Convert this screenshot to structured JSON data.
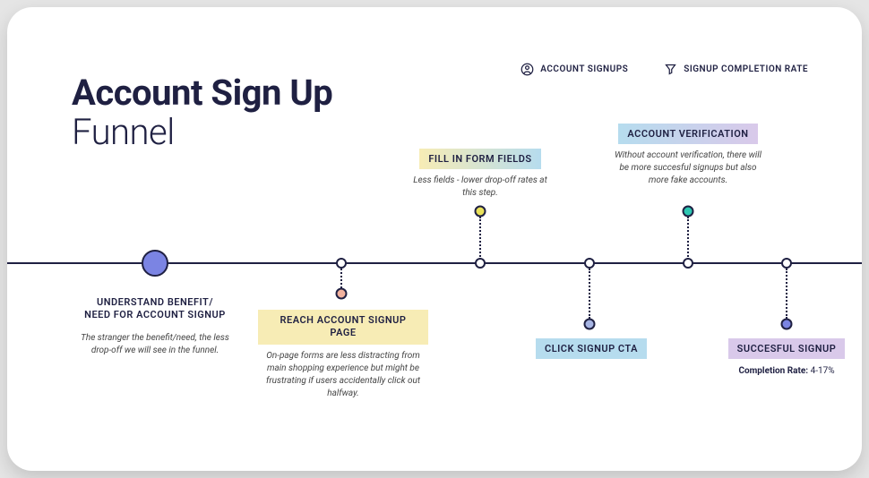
{
  "title": {
    "main": "Account Sign Up",
    "sub": "Funnel"
  },
  "legend": {
    "signups": "ACCOUNT SIGNUPS",
    "completion": "SIGNUP COMPLETION RATE"
  },
  "steps": {
    "s1": {
      "label": "UNDERSTAND BENEFIT/ NEED FOR ACCOUNT SIGNUP",
      "desc": "The stranger the benefit/need, the less drop-off we will see in the funnel."
    },
    "s2": {
      "label": "REACH ACCOUNT SIGNUP PAGE",
      "desc": "On-page forms are less distracting from main shopping experience but might be frustrating if users accidentally click out halfway."
    },
    "s3": {
      "label": "FILL IN FORM FIELDS",
      "desc": "Less fields - lower drop-off rates at this step."
    },
    "s4": {
      "label": "CLICK SIGNUP CTA"
    },
    "s5": {
      "label": "ACCOUNT VERIFICATION",
      "desc": "Without account verification, there will be more succesful signups but also more fake accounts."
    },
    "s6": {
      "label": "SUCCESFUL SIGNUP",
      "completion_label": "Completion Rate:",
      "completion_value": "4-17%"
    }
  },
  "colors": {
    "s2_tag": "#f7ecb5",
    "s3_tag_from": "#f7ecb5",
    "s3_tag_to": "#b6dcee",
    "s4_tag": "#b6dcee",
    "s5_tag_from": "#b6dcee",
    "s5_tag_to": "#d9c9ea",
    "s6_tag": "#d9c9ea",
    "dot_s2": "#f2b29e",
    "dot_s3": "#e9e15a",
    "dot_s4": "#a6b4e3",
    "dot_s5": "#2dc7b2",
    "dot_s6": "#7b84e3"
  }
}
